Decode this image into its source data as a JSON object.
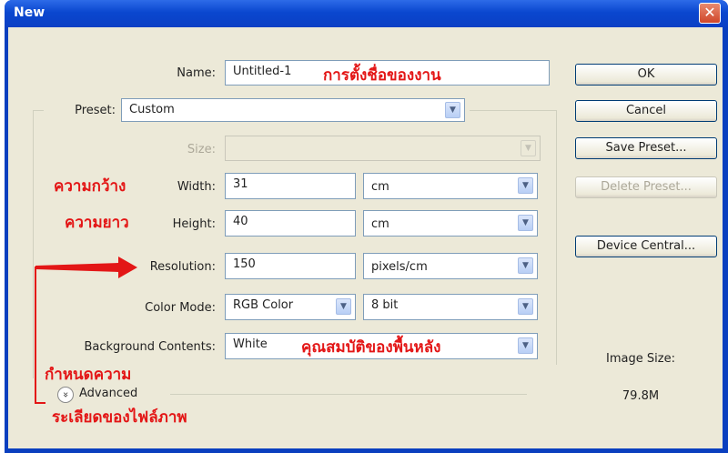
{
  "window": {
    "title": "New",
    "close_glyph": "✕"
  },
  "form": {
    "name_label": "Name:",
    "name_value": "Untitled-1",
    "preset_label": "Preset:",
    "preset_value": "Custom",
    "size_label": "Size:",
    "size_value": "",
    "width_label": "Width:",
    "width_value": "31",
    "width_unit": "cm",
    "height_label": "Height:",
    "height_value": "40",
    "height_unit": "cm",
    "resolution_label": "Resolution:",
    "resolution_value": "150",
    "resolution_unit": "pixels/cm",
    "color_mode_label": "Color Mode:",
    "color_mode_value": "RGB Color",
    "bit_depth_value": "8 bit",
    "background_label": "Background Contents:",
    "background_value": "White",
    "advanced_label": "Advanced",
    "advanced_icon": "»"
  },
  "buttons": {
    "ok": "OK",
    "cancel": "Cancel",
    "save_preset": "Save Preset...",
    "delete_preset": "Delete Preset...",
    "device_central": "Device Central..."
  },
  "image_size": {
    "label": "Image Size:",
    "value": "79.8M"
  },
  "annotations": {
    "name": "การตั้งชื่อของงาน",
    "width": "ความกว้าง",
    "height": "ความยาว",
    "background": "คุณสมบัติของพื้นหลัง",
    "resolution_1": "กำหนดความ",
    "resolution_2": "ระเลียดของไฟล์ภาพ"
  },
  "colors": {
    "annotation": "#e31616",
    "titlebar": "#0a47cf",
    "dialog_bg": "#ece9d8"
  }
}
